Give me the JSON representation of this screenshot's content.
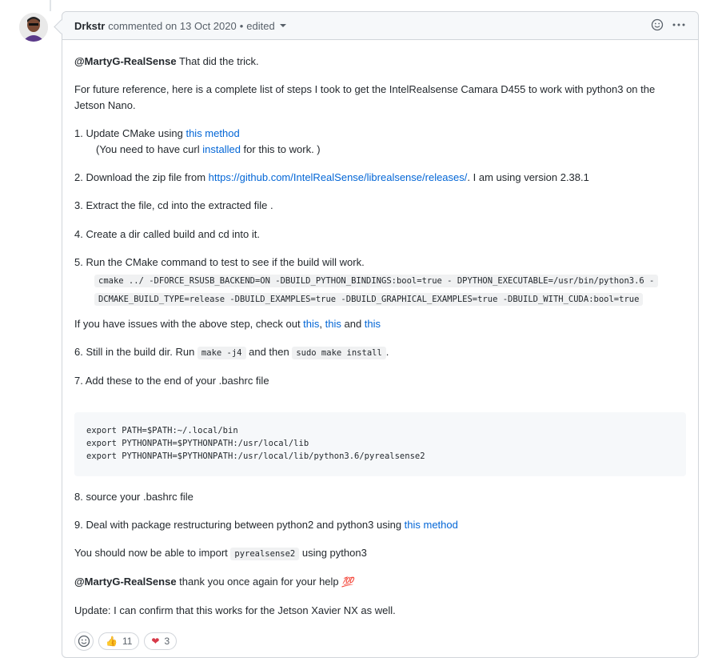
{
  "header": {
    "author": "Drkstr",
    "commented_text": "commented on 13 Oct 2020",
    "edited": "edited",
    "bullet": "•"
  },
  "body": {
    "p1_mention": "@MartyG-RealSense",
    "p1_text": " That did the trick.",
    "p2_line1": "For future reference, here is a complete list of steps I took to get the IntelRealsense Camara D455 to work with python3 on the",
    "p2_line2": "Jetson Nano.",
    "s1_prefix": "1. Update CMake using ",
    "s1_link": "this method",
    "s1b_prefix": "(You need to have curl ",
    "s1b_link": "installed",
    "s1b_suffix": " for this to work. )",
    "s2_prefix": "2. Download the zip file from ",
    "s2_link": "https://github.com/IntelRealSense/librealsense/releases/",
    "s2_suffix": ". I am using version 2.38.1",
    "s3": "3. Extract the file, cd into the extracted file .",
    "s4": "4. Create a dir called build and cd into it.",
    "s5": "5. Run the CMake command to test to see if the build will work.",
    "s5_code1": "cmake ../ -DFORCE_RSUSB_BACKEND=ON -DBUILD_PYTHON_BINDINGS:bool=true - DPYTHON_EXECUTABLE=/usr/bin/python3.6 -",
    "s5_code2": "DCMAKE_BUILD_TYPE=release -DBUILD_EXAMPLES=true -DBUILD_GRAPHICAL_EXAMPLES=true -DBUILD_WITH_CUDA:bool=true",
    "issues_prefix": "If you have issues with the above step, check out ",
    "issues_link1": "this",
    "issues_comma": ", ",
    "issues_link2": "this",
    "issues_and": " and ",
    "issues_link3": "this",
    "s6_prefix": "6. Still in the build dir. Run ",
    "s6_code1": "make -j4",
    "s6_mid": " and then ",
    "s6_code2": "sudo make install",
    "s6_suffix": ".",
    "s7": "7. Add these to the end of your .bashrc file",
    "pre": "export PATH=$PATH:~/.local/bin\nexport PYTHONPATH=$PYTHONPATH:/usr/local/lib\nexport PYTHONPATH=$PYTHONPATH:/usr/local/lib/python3.6/pyrealsense2",
    "s8": "8. source your .bashrc file",
    "s9_prefix": "9. Deal with package restructuring between python2 and python3 using ",
    "s9_link": "this method",
    "import_prefix": "You should now be able to import ",
    "import_code": "pyrealsense2",
    "import_suffix": " using python3",
    "thanks_mention": "@MartyG-RealSense",
    "thanks_text": " thank you once again for your help ",
    "thanks_emoji": "💯",
    "update": "Update: I can confirm that this works for the Jetson Xavier NX as well."
  },
  "reactions": {
    "thumbs_emoji": "👍",
    "thumbs_count": "11",
    "heart_emoji": "❤",
    "heart_count": "3"
  }
}
